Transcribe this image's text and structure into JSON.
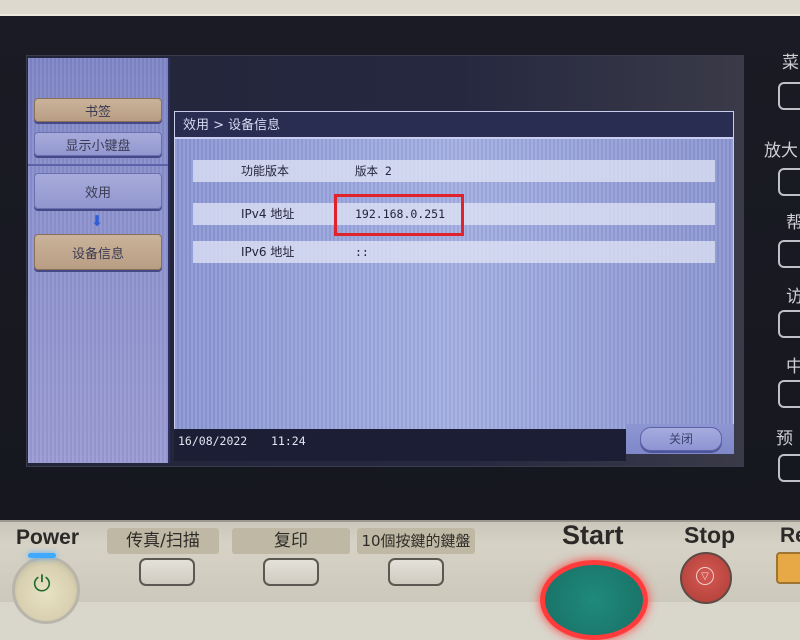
{
  "sidebar": {
    "bookmark_label": "书签",
    "show_keypad_label": "显示小键盘",
    "utility_label": "效用",
    "device_info_label": "设备信息",
    "arrow_icon": "down-arrow-icon"
  },
  "dialog": {
    "breadcrumb": "效用 > 设备信息",
    "rows": [
      {
        "label": "功能版本",
        "value": "版本 2"
      },
      {
        "label": "IPv4 地址",
        "value": "192.168.0.251"
      },
      {
        "label": "IPv6 地址",
        "value": "::"
      }
    ],
    "highlight_color": "#e0222a"
  },
  "status": {
    "date": "16/08/2022",
    "time": "11:24"
  },
  "close_label": "关闭",
  "hardware_right": {
    "labels": [
      "菜",
      "放大",
      "帮",
      "访",
      "中",
      "预"
    ]
  },
  "hardware_bottom": {
    "power_label": "Power",
    "fax_scan_label": "传真/扫描",
    "copy_label": "复印",
    "tenkey_label": "10個按鍵的鍵盤",
    "start_label": "Start",
    "stop_label": "Stop",
    "reset_label": "Re"
  },
  "colors": {
    "screen_accent": "#8c98d6",
    "title_bar": "#2a2d52",
    "start_ring": "#ff3b3b",
    "start_fill": "#1b7a6e",
    "stop_fill": "#b9453f",
    "power_led": "#3fa8ff"
  }
}
